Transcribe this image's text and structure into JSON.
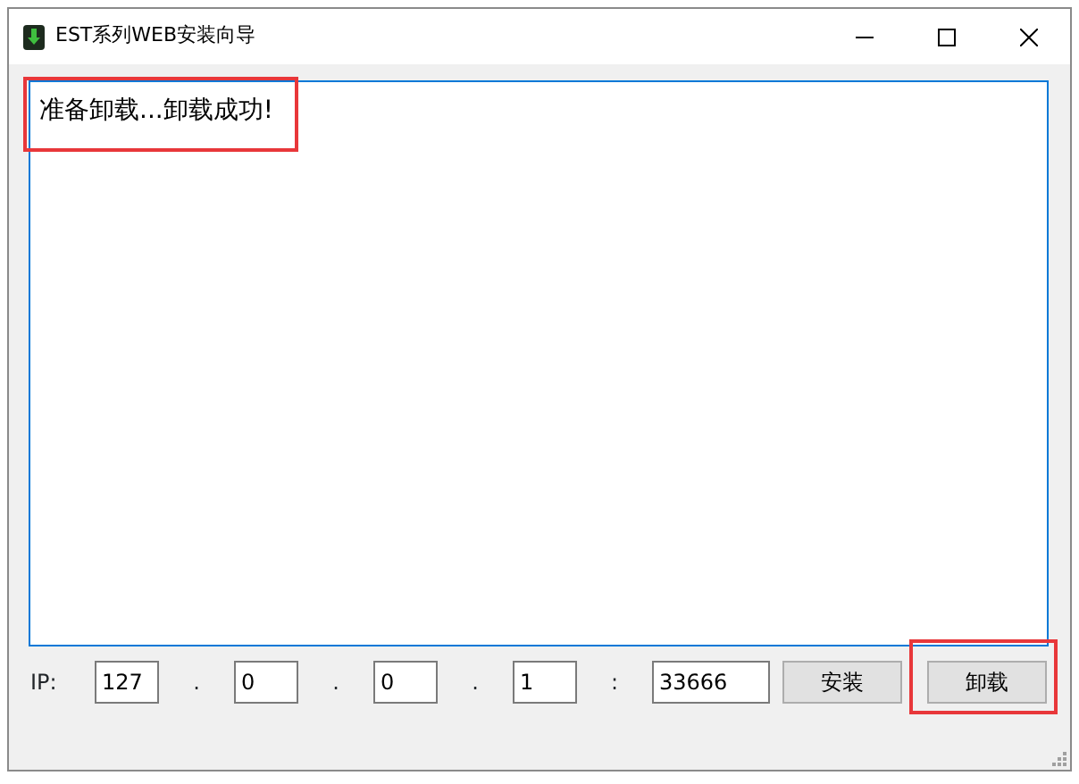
{
  "window": {
    "title": "EST系列WEB安装向导"
  },
  "log": {
    "text": "准备卸载...卸载成功!",
    "highlighted": true
  },
  "address": {
    "label": "IP:",
    "octets": [
      "127",
      "0",
      "0",
      "1"
    ],
    "separator": ".",
    "port_separator": ":",
    "port": "33666"
  },
  "buttons": [
    {
      "label": "安装",
      "highlighted": false
    },
    {
      "label": "卸载",
      "highlighted": true
    }
  ]
}
